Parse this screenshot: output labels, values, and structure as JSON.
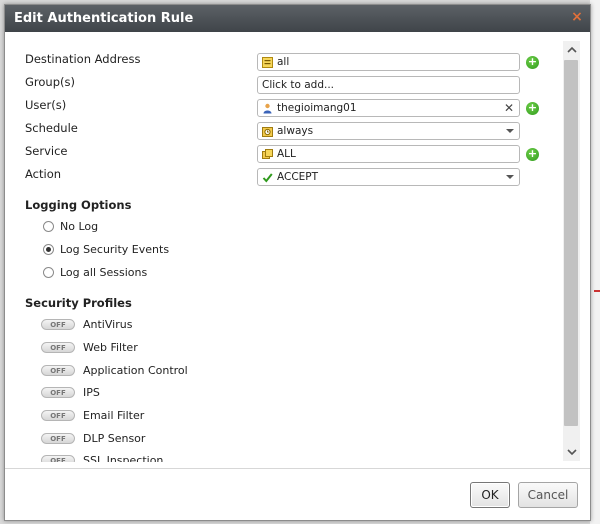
{
  "dialog": {
    "title": "Edit Authentication Rule",
    "close_glyph": "×"
  },
  "form": {
    "destination": {
      "label": "Destination Address",
      "value": "all",
      "icon": "address-icon"
    },
    "groups": {
      "label": "Group(s)",
      "placeholder": "Click to add..."
    },
    "users": {
      "label": "User(s)",
      "value": "thegioimang01",
      "icon": "user-icon",
      "clear_glyph": "✕"
    },
    "schedule": {
      "label": "Schedule",
      "value": "always",
      "icon": "schedule-icon"
    },
    "service": {
      "label": "Service",
      "value": "ALL",
      "icon": "service-icon"
    },
    "action": {
      "label": "Action",
      "value": "ACCEPT",
      "icon": "check-icon"
    }
  },
  "logging": {
    "title": "Logging Options",
    "options": [
      {
        "label": "No Log",
        "checked": false
      },
      {
        "label": "Log Security Events",
        "checked": true
      },
      {
        "label": "Log all Sessions",
        "checked": false
      }
    ]
  },
  "security_profiles": {
    "title": "Security Profiles",
    "toggle_text": "OFF",
    "items": [
      {
        "label": "AntiVirus"
      },
      {
        "label": "Web Filter"
      },
      {
        "label": "Application Control"
      },
      {
        "label": "IPS"
      },
      {
        "label": "Email Filter"
      },
      {
        "label": "DLP Sensor"
      },
      {
        "label": "SSL Inspection"
      }
    ]
  },
  "footer": {
    "ok_label": "OK",
    "cancel_label": "Cancel"
  },
  "colors": {
    "titlebar": "#4a4f54",
    "accent_plus": "#3aa92a",
    "close": "#e0703a"
  }
}
